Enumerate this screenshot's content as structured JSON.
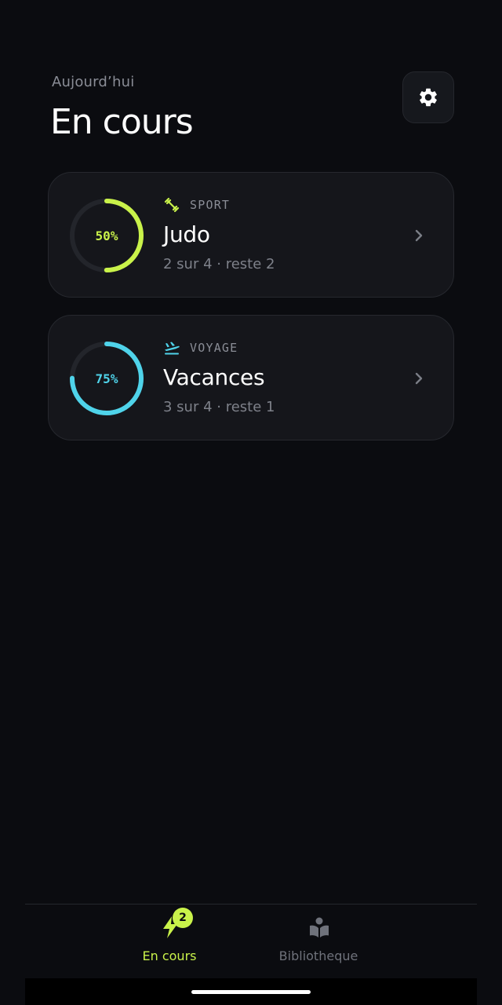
{
  "header": {
    "subtitle": "Aujourd’hui",
    "title": "En cours",
    "settings_icon": "gear-icon"
  },
  "cards": [
    {
      "percent_label": "50%",
      "progress": 0.5,
      "color": "#c9f24a",
      "category": "SPORT",
      "category_icon": "dumbbell-icon",
      "title": "Judo",
      "subtitle": "2 sur 4 · reste 2"
    },
    {
      "percent_label": "75%",
      "progress": 0.75,
      "color": "#4fd3ea",
      "category": "VOYAGE",
      "category_icon": "plane-departure-icon",
      "title": "Vacances",
      "subtitle": "3 sur 4 · reste 1"
    }
  ],
  "tabbar": {
    "tabs": [
      {
        "label": "En cours",
        "icon": "lightning-icon",
        "badge": "2",
        "active": true
      },
      {
        "label": "Bibliotheque",
        "icon": "reader-book-icon",
        "active": false
      }
    ],
    "accent": "#c9f24a",
    "inactive": "#6f727b"
  },
  "colors": {
    "background": "#0b0c10",
    "card": "#15161b",
    "ring_track": "#23252b"
  }
}
